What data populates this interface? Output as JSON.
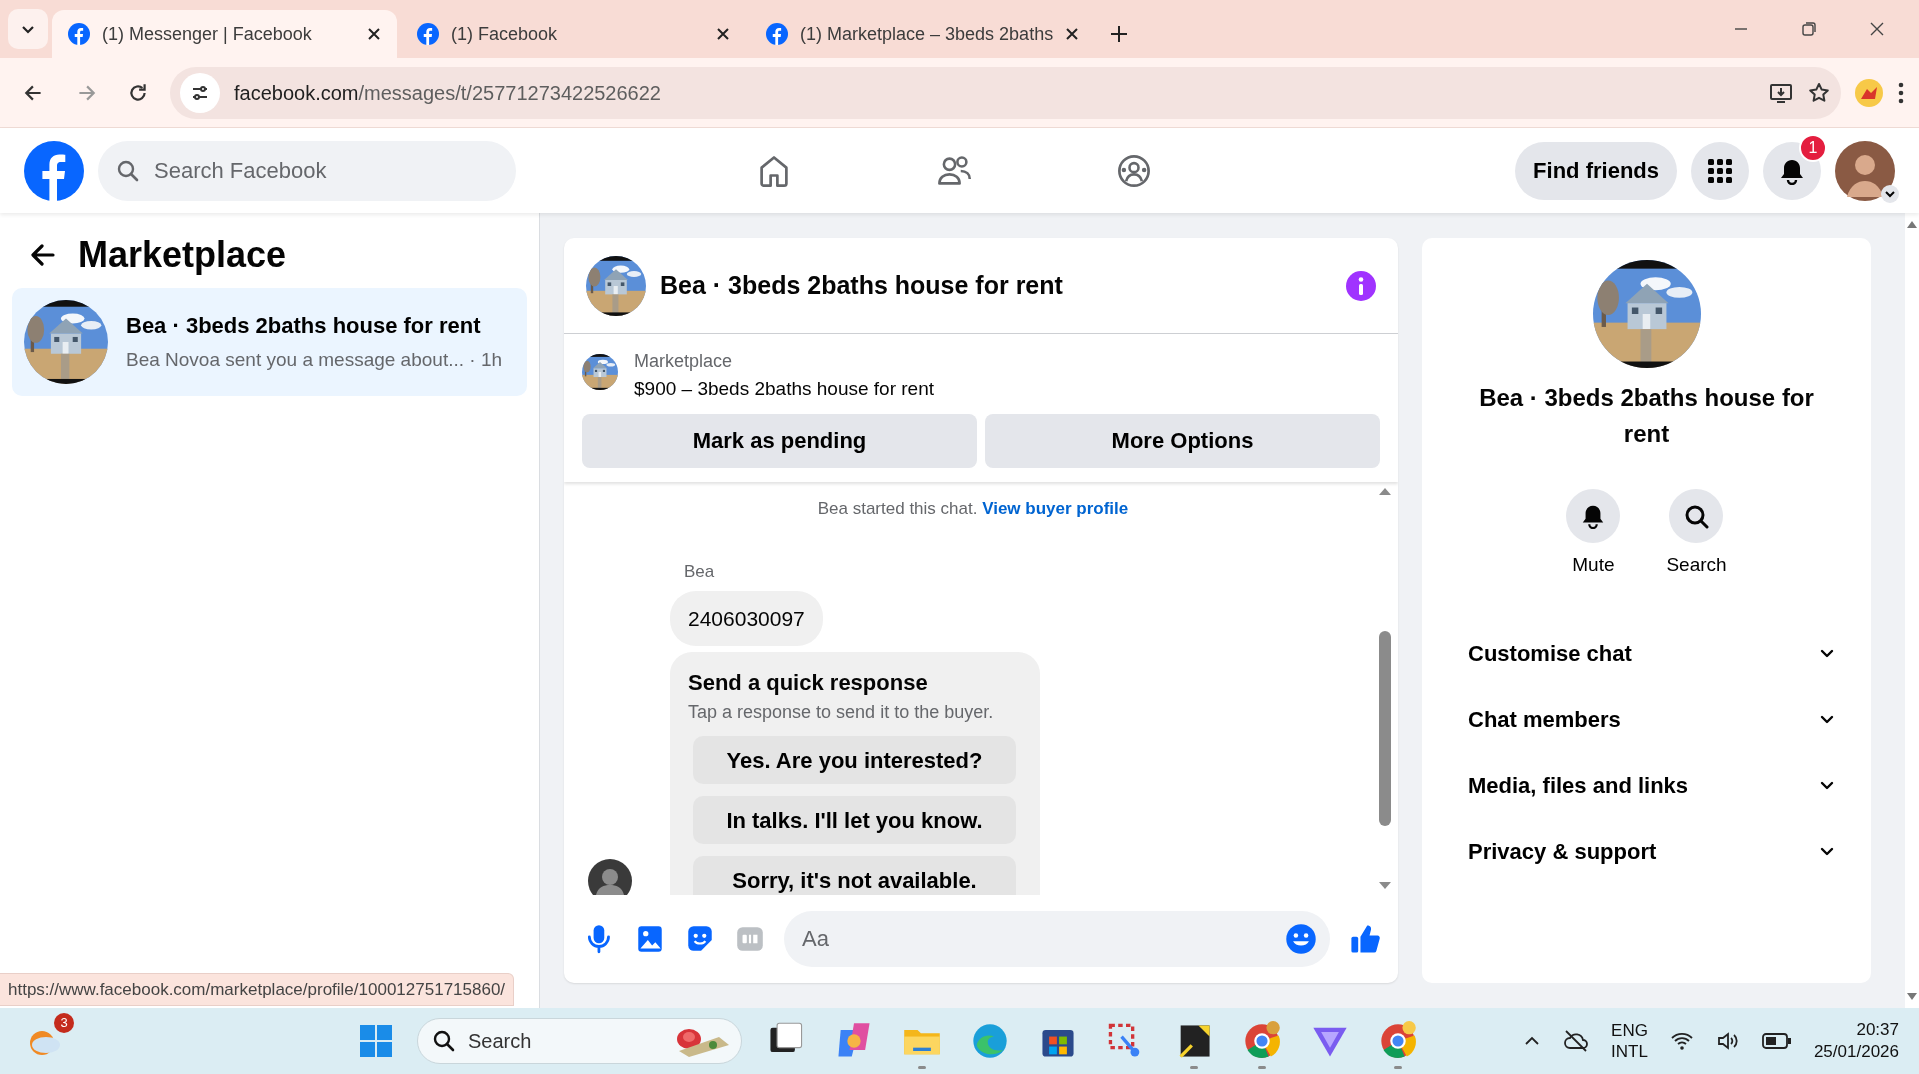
{
  "browser": {
    "tabs": [
      {
        "title": "(1) Messenger | Facebook",
        "selected": true
      },
      {
        "title": "(1) Facebook",
        "selected": false
      },
      {
        "title": "(1) Marketplace – 3beds 2baths",
        "selected": false
      }
    ],
    "url_host": "facebook.com",
    "url_path": "/messages/t/25771273422526622",
    "status_url": "https://www.facebook.com/marketplace/profile/100012751715860/"
  },
  "header": {
    "search_placeholder": "Search Facebook",
    "find_friends": "Find friends",
    "notification_count": "1"
  },
  "sidebar": {
    "title": "Marketplace",
    "conversations": [
      {
        "title": "Bea · 3beds 2baths house for rent",
        "preview": "Bea Novoa sent you a message about...",
        "separator": "·",
        "time": "1h",
        "selected": true
      }
    ]
  },
  "chat": {
    "title": "Bea · 3beds 2baths house for rent",
    "listing": {
      "label": "Marketplace",
      "title": "$900 – 3beds 2baths house for rent",
      "buttons": [
        "Mark as pending",
        "More Options"
      ]
    },
    "notice": {
      "text": "Bea started this chat.",
      "link": "View buyer profile"
    },
    "sender": "Bea",
    "message": "2406030097",
    "quick_response": {
      "title": "Send a quick response",
      "subtitle": "Tap a response to send it to the buyer.",
      "options": [
        "Yes. Are you interested?",
        "In talks. I'll let you know.",
        "Sorry, it's not available."
      ]
    },
    "composer_placeholder": "Aa"
  },
  "details": {
    "title": "Bea · 3beds 2baths house for rent",
    "actions": [
      {
        "kind": "mute",
        "label": "Mute"
      },
      {
        "kind": "search",
        "label": "Search"
      }
    ],
    "sections": [
      {
        "label": "Customise chat",
        "expanded": false
      },
      {
        "label": "Chat members",
        "expanded": false
      },
      {
        "label": "Media, files and links",
        "expanded": false
      },
      {
        "label": "Privacy & support",
        "expanded": false
      }
    ]
  },
  "taskbar": {
    "weather_badge": "3",
    "search_placeholder": "Search",
    "language": "ENG",
    "layout": "INTL",
    "time": "20:37",
    "date": "25/01/2026"
  }
}
